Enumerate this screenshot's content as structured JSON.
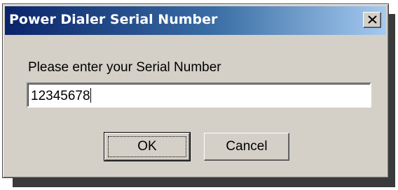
{
  "window": {
    "title": "Power Dialer Serial Number",
    "close_symbol": "✕"
  },
  "form": {
    "prompt": "Please enter your Serial Number",
    "serial_value": "12345678"
  },
  "buttons": {
    "ok_label": "OK",
    "cancel_label": "Cancel"
  },
  "colors": {
    "titlebar_start": "#0a246a",
    "titlebar_end": "#a6caf0",
    "dialog_face": "#d4d0c8"
  }
}
